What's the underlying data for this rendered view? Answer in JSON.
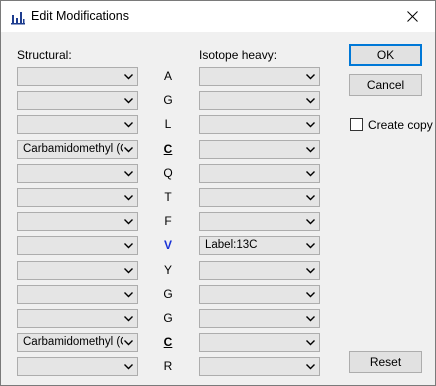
{
  "window": {
    "title": "Edit Modifications"
  },
  "labels": {
    "structural": "Structural:",
    "isotope_heavy": "Isotope heavy:"
  },
  "buttons": {
    "ok": "OK",
    "cancel": "Cancel",
    "reset": "Reset"
  },
  "create_copy": {
    "label": "Create copy",
    "checked": false
  },
  "rows": [
    {
      "aa": "A",
      "structural": "",
      "heavy": "",
      "style": "normal"
    },
    {
      "aa": "G",
      "structural": "",
      "heavy": "",
      "style": "normal"
    },
    {
      "aa": "L",
      "structural": "",
      "heavy": "",
      "style": "normal"
    },
    {
      "aa": "C",
      "structural": "Carbamidomethyl (C)",
      "heavy": "",
      "style": "bold-under"
    },
    {
      "aa": "Q",
      "structural": "",
      "heavy": "",
      "style": "normal"
    },
    {
      "aa": "T",
      "structural": "",
      "heavy": "",
      "style": "normal"
    },
    {
      "aa": "F",
      "structural": "",
      "heavy": "",
      "style": "normal"
    },
    {
      "aa": "V",
      "structural": "",
      "heavy": "Label:13C",
      "style": "blue"
    },
    {
      "aa": "Y",
      "structural": "",
      "heavy": "",
      "style": "normal"
    },
    {
      "aa": "G",
      "structural": "",
      "heavy": "",
      "style": "normal"
    },
    {
      "aa": "G",
      "structural": "",
      "heavy": "",
      "style": "normal"
    },
    {
      "aa": "C",
      "structural": "Carbamidomethyl (C)",
      "heavy": "",
      "style": "bold-under"
    },
    {
      "aa": "R",
      "structural": "",
      "heavy": "",
      "style": "normal"
    }
  ],
  "colors": {
    "modified_aa": "#1a33d6",
    "default_button_border": "#0078d7"
  }
}
